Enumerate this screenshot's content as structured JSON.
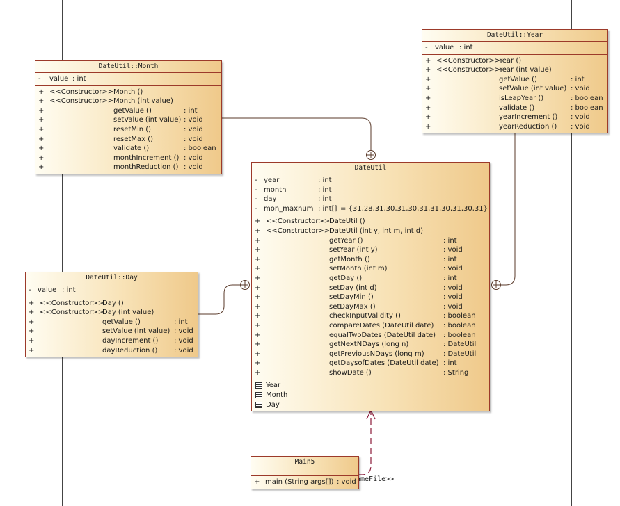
{
  "classes": {
    "month": {
      "title": "DateUtil::Month",
      "attributes": [
        {
          "vis": "-",
          "name": "value",
          "type": ": int"
        }
      ],
      "operations": [
        {
          "vis": "+",
          "stereo": "<<Constructor>>",
          "name": "Month ()",
          "type": ""
        },
        {
          "vis": "+",
          "stereo": "<<Constructor>>",
          "name": "Month (int value)",
          "type": ""
        },
        {
          "vis": "+",
          "stereo": "",
          "name": "getValue ()",
          "type": ": int"
        },
        {
          "vis": "+",
          "stereo": "",
          "name": "setValue (int value)",
          "type": ": void"
        },
        {
          "vis": "+",
          "stereo": "",
          "name": "resetMin ()",
          "type": ": void"
        },
        {
          "vis": "+",
          "stereo": "",
          "name": "resetMax ()",
          "type": ": void"
        },
        {
          "vis": "+",
          "stereo": "",
          "name": "validate ()",
          "type": ": boolean"
        },
        {
          "vis": "+",
          "stereo": "",
          "name": "monthIncrement ()",
          "type": ": void"
        },
        {
          "vis": "+",
          "stereo": "",
          "name": "monthReduction ()",
          "type": ": void"
        }
      ]
    },
    "year": {
      "title": "DateUtil::Year",
      "attributes": [
        {
          "vis": "-",
          "name": "value",
          "type": ": int"
        }
      ],
      "operations": [
        {
          "vis": "+",
          "stereo": "<<Constructor>>",
          "name": "Year ()",
          "type": ""
        },
        {
          "vis": "+",
          "stereo": "<<Constructor>>",
          "name": "Year (int value)",
          "type": ""
        },
        {
          "vis": "+",
          "stereo": "",
          "name": "getValue ()",
          "type": ": int"
        },
        {
          "vis": "+",
          "stereo": "",
          "name": "setValue (int value)",
          "type": ": void"
        },
        {
          "vis": "+",
          "stereo": "",
          "name": "isLeapYear ()",
          "type": ": boolean"
        },
        {
          "vis": "+",
          "stereo": "",
          "name": "validate ()",
          "type": ": boolean"
        },
        {
          "vis": "+",
          "stereo": "",
          "name": "yearIncrement ()",
          "type": ": void"
        },
        {
          "vis": "+",
          "stereo": "",
          "name": "yearReduction ()",
          "type": ": void"
        }
      ]
    },
    "dateutil": {
      "title": "DateUtil",
      "attributes": [
        {
          "vis": "-",
          "name": "year",
          "type": ": int",
          "extra": ""
        },
        {
          "vis": "-",
          "name": "month",
          "type": ": int",
          "extra": ""
        },
        {
          "vis": "-",
          "name": "day",
          "type": ": int",
          "extra": ""
        },
        {
          "vis": "-",
          "name": "mon_maxnum",
          "type": ": int[]",
          "extra": "= {31,28,31,30,31,30,31,31,30,31,30,31}"
        }
      ],
      "operations": [
        {
          "vis": "+",
          "stereo": "<<Constructor>>",
          "name": "DateUtil ()",
          "type": ""
        },
        {
          "vis": "+",
          "stereo": "<<Constructor>>",
          "name": "DateUtil (int y, int m, int d)",
          "type": ""
        },
        {
          "vis": "+",
          "stereo": "",
          "name": "getYear ()",
          "type": ": int"
        },
        {
          "vis": "+",
          "stereo": "",
          "name": "setYear (int y)",
          "type": ": void"
        },
        {
          "vis": "+",
          "stereo": "",
          "name": "getMonth ()",
          "type": ": int"
        },
        {
          "vis": "+",
          "stereo": "",
          "name": "setMonth (int m)",
          "type": ": void"
        },
        {
          "vis": "+",
          "stereo": "",
          "name": "getDay ()",
          "type": ": int"
        },
        {
          "vis": "+",
          "stereo": "",
          "name": "setDay (int d)",
          "type": ": void"
        },
        {
          "vis": "+",
          "stereo": "",
          "name": "setDayMin ()",
          "type": ": void"
        },
        {
          "vis": "+",
          "stereo": "",
          "name": "setDayMax ()",
          "type": ": void"
        },
        {
          "vis": "+",
          "stereo": "",
          "name": "checkInputValidity ()",
          "type": ": boolean"
        },
        {
          "vis": "+",
          "stereo": "",
          "name": "compareDates (DateUtil date)",
          "type": ": boolean"
        },
        {
          "vis": "+",
          "stereo": "",
          "name": "equalTwoDates (DateUtil date)",
          "type": ": boolean"
        },
        {
          "vis": "+",
          "stereo": "",
          "name": "getNextNDays (long n)",
          "type": ": DateUtil"
        },
        {
          "vis": "+",
          "stereo": "",
          "name": "getPreviousNDays (long m)",
          "type": ": DateUtil"
        },
        {
          "vis": "+",
          "stereo": "",
          "name": "getDaysofDates (DateUtil date)",
          "type": ": int"
        },
        {
          "vis": "+",
          "stereo": "",
          "name": "showDate ()",
          "type": ": String"
        }
      ],
      "inner_classes": [
        "Year",
        "Month",
        "Day"
      ]
    },
    "day": {
      "title": "DateUtil::Day",
      "attributes": [
        {
          "vis": "-",
          "name": "value",
          "type": ": int"
        }
      ],
      "operations": [
        {
          "vis": "+",
          "stereo": "<<Constructor>>",
          "name": "Day ()",
          "type": ""
        },
        {
          "vis": "+",
          "stereo": "<<Constructor>>",
          "name": "Day (int value)",
          "type": ""
        },
        {
          "vis": "+",
          "stereo": "",
          "name": "getValue ()",
          "type": ": int"
        },
        {
          "vis": "+",
          "stereo": "",
          "name": "setValue (int value)",
          "type": ": void"
        },
        {
          "vis": "+",
          "stereo": "",
          "name": "dayIncrement ()",
          "type": ": void"
        },
        {
          "vis": "+",
          "stereo": "",
          "name": "dayReduction ()",
          "type": ": void"
        }
      ]
    },
    "main5": {
      "title": "Main5",
      "attributes": [],
      "operations": [
        {
          "vis": "+",
          "stereo": "",
          "name": "main (String args[])",
          "type": ": void"
        }
      ]
    }
  },
  "dependency_label": "ameFile>>",
  "colors": {
    "border": "#9c3a2a",
    "fill_light": "#fffdf2",
    "fill_dark": "#efc98a",
    "dependency": "#8b1a3a"
  }
}
